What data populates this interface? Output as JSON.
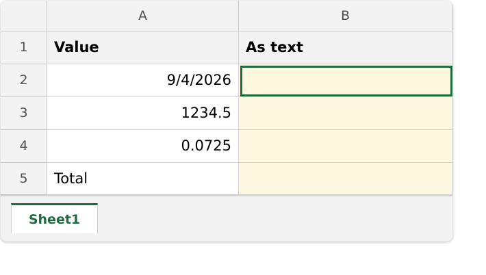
{
  "columns": [
    "A",
    "B"
  ],
  "rows": [
    {
      "number": "1",
      "a": "Value",
      "b": "As text"
    },
    {
      "number": "2",
      "a": "9/4/2026",
      "b": ""
    },
    {
      "number": "3",
      "a": "1234.5",
      "b": ""
    },
    {
      "number": "4",
      "a": "0.0725",
      "b": ""
    },
    {
      "number": "5",
      "a": "Total",
      "b": ""
    }
  ],
  "active_cell": "B2",
  "sheet_tabs": [
    {
      "label": "Sheet1",
      "active": true
    }
  ],
  "colors": {
    "accent": "#1e6b40",
    "answer_fill": "#fdf7df",
    "header_fill": "#f3f3f3",
    "gridline": "#d4d4d4"
  }
}
